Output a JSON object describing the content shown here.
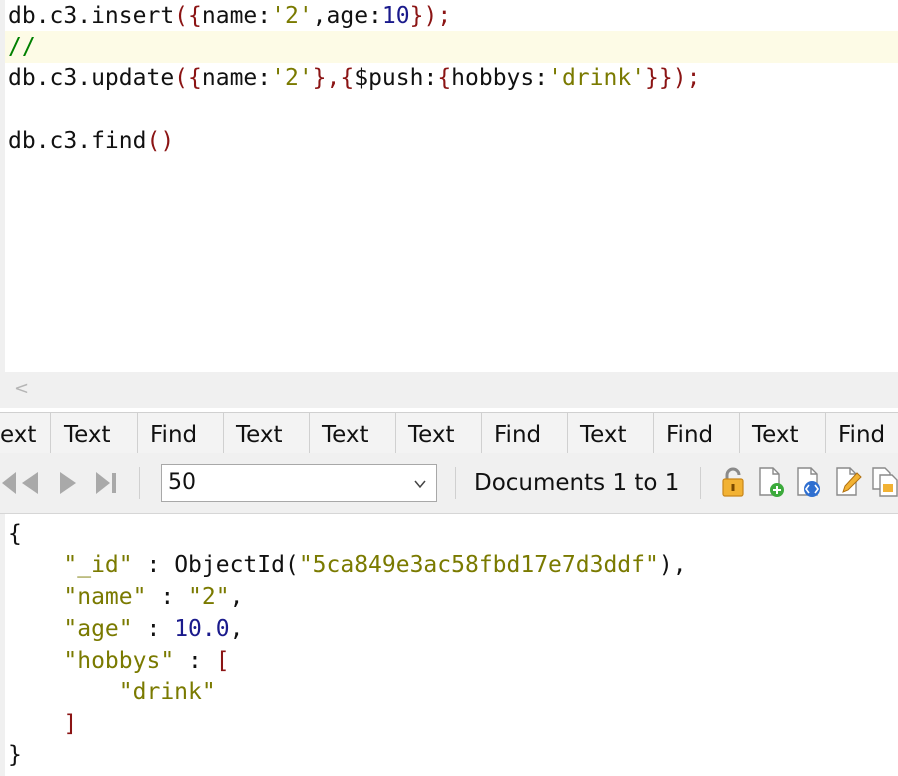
{
  "editor": {
    "line1": {
      "a": "db.c3.insert",
      "b": "({",
      "c": "name:",
      "d": "'2'",
      "e": ",age:",
      "f": "10",
      "g": "});"
    },
    "line2": {
      "comment": "//"
    },
    "line3": {
      "a": "db.c3.update",
      "b": "({",
      "c": "name:",
      "d": "'2'",
      "e": "},{",
      "f": "$push:",
      "g": "{",
      "h": "hobbys:",
      "i": "'drink'",
      "j": "}});"
    },
    "line5": {
      "a": "db.c3.find",
      "b": "()"
    }
  },
  "hscroll": {
    "left_arrow": "<"
  },
  "tabs": [
    {
      "label": "ext"
    },
    {
      "label": "Text"
    },
    {
      "label": "Find"
    },
    {
      "label": "Text"
    },
    {
      "label": "Text"
    },
    {
      "label": "Text"
    },
    {
      "label": "Find"
    },
    {
      "label": "Text"
    },
    {
      "label": "Find"
    },
    {
      "label": "Text"
    },
    {
      "label": "Find"
    }
  ],
  "toolbar": {
    "page_size": "50",
    "documents_label": "Documents 1 to 1",
    "icons": [
      "first-page-icon",
      "previous-page-icon",
      "next-page-icon",
      "last-page-icon",
      "lock-icon",
      "new-document-icon",
      "view-document-icon",
      "edit-document-icon",
      "copy-document-icon"
    ]
  },
  "result": {
    "open": "{",
    "id_key": "\"_id\"",
    "colon": " : ",
    "id_fn": "ObjectId(",
    "id_val": "\"5ca849e3ac58fbd17e7d3ddf\"",
    "id_close": "),",
    "name_key": "\"name\"",
    "name_val": "\"2\"",
    "comma": ",",
    "age_key": "\"age\"",
    "age_val": "10.0",
    "hobbys_key": "\"hobbys\"",
    "arr_open": "[",
    "hobby0": "\"drink\"",
    "arr_close": "]",
    "close": "}"
  },
  "colors": {
    "bracket": "#8b1414",
    "string": "#7a7a00",
    "number": "#1a1a8c",
    "comment": "#008000"
  }
}
